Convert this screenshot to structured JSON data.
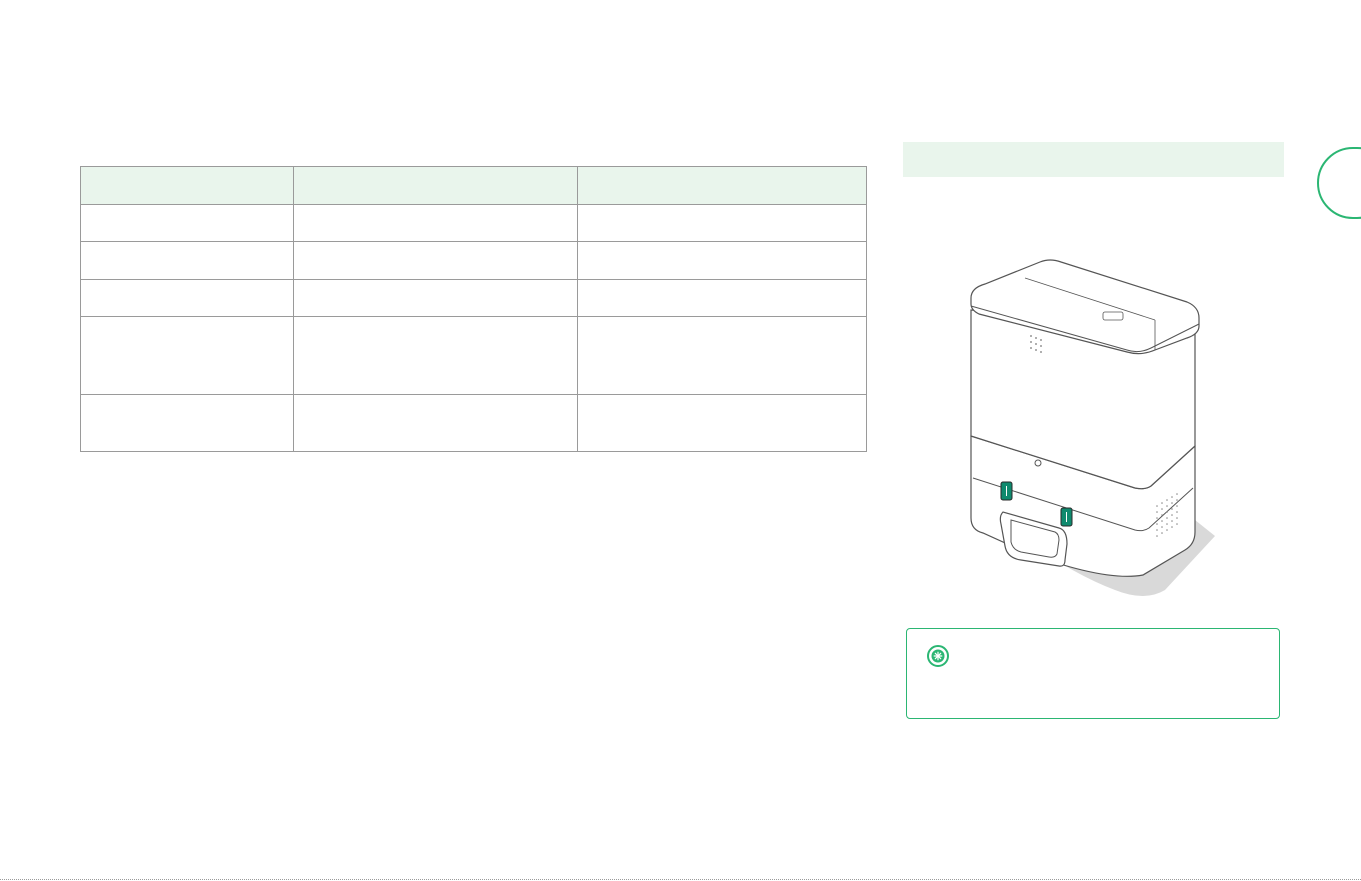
{
  "table": {
    "headers": [
      "",
      "",
      ""
    ],
    "rows": [
      [
        "",
        "",
        ""
      ],
      [
        "",
        "",
        ""
      ],
      [
        "",
        "",
        ""
      ],
      [
        "",
        "",
        ""
      ],
      [
        "",
        "",
        ""
      ]
    ]
  },
  "section_header": "",
  "tip": {
    "icon": "tip-icon",
    "text": ""
  },
  "colors": {
    "accent": "#2bb673",
    "header_fill": "#e9f5ec",
    "text": "#333333",
    "border": "#9a9a9a"
  }
}
